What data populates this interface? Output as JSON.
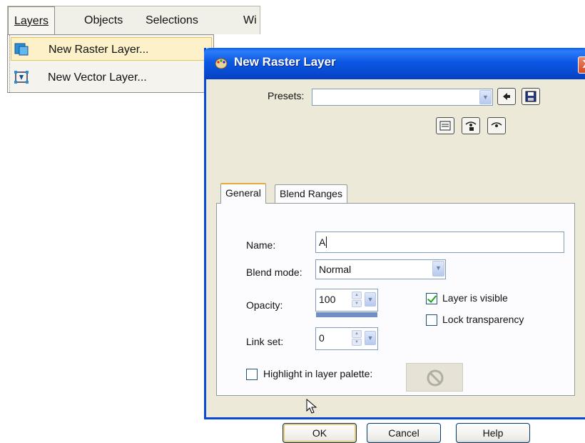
{
  "menubar": {
    "items": [
      "Layers",
      "Objects",
      "Selections",
      "Wi"
    ]
  },
  "menu": {
    "items": [
      {
        "label": "New Raster Layer...",
        "icon": "raster-layer-icon"
      },
      {
        "label": "New Vector Layer...",
        "icon": "vector-layer-icon"
      }
    ]
  },
  "dialog": {
    "title": "New Raster Layer",
    "close_label": "X",
    "presets": {
      "label": "Presets:",
      "value": ""
    },
    "tabs": [
      "General",
      "Blend Ranges"
    ],
    "name": {
      "label": "Name:",
      "value": "A"
    },
    "blend_mode": {
      "label": "Blend mode:",
      "value": "Normal"
    },
    "opacity": {
      "label": "Opacity:",
      "value": "100"
    },
    "link_set": {
      "label": "Link set:",
      "value": "0"
    },
    "layer_visible": {
      "label": "Layer is visible",
      "checked": true
    },
    "lock_transparency": {
      "label": "Lock transparency",
      "checked": false
    },
    "highlight": {
      "label": "Highlight in layer palette:",
      "checked": false
    },
    "buttons": {
      "ok": "OK",
      "cancel": "Cancel",
      "help": "Help"
    }
  },
  "colors": {
    "titlebar": "#0a5ff0",
    "dialog_bg": "#ece9d8",
    "menu_highlight": "#fcf1c8",
    "default_button_glow": "#f4c868"
  }
}
